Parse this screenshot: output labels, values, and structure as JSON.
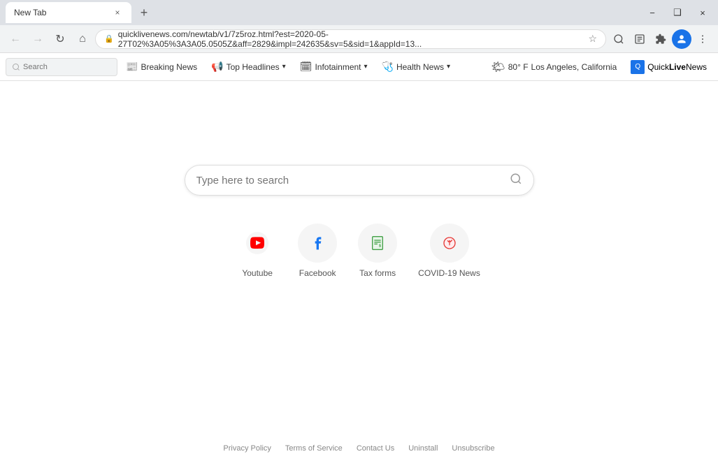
{
  "titleBar": {
    "tabLabel": "New Tab",
    "closeBtn": "×",
    "newTabBtn": "+",
    "minimizeBtn": "−",
    "maximizeBtn": "❑",
    "closeWindowBtn": "×"
  },
  "addressBar": {
    "url": "quicklivenews.com/newtab/v1/7z5roz.html?est=2020-05-27T02%3A05%3A3A05.0505Z&aff=2829&impl=242635&sv=5&sid=1&appId=13...",
    "lockIcon": "🔒"
  },
  "newsBar": {
    "searchPlaceholder": "Search",
    "breakingNewsLabel": "Breaking News",
    "topHeadlinesLabel": "Top Headlines",
    "infotainmentLabel": "Infotainment",
    "healthNewsLabel": "Health News",
    "weatherTemp": "80° F",
    "weatherLocation": "Los Angeles, California",
    "weatherIcon": "🌤",
    "quickLiveNewsLabel": "QuickLiveNews",
    "quickLiveNewsHighlight": "Live"
  },
  "mainContent": {
    "searchPlaceholder": "Type here to search",
    "shortcuts": [
      {
        "id": "youtube",
        "label": "Youtube",
        "type": "youtube"
      },
      {
        "id": "facebook",
        "label": "Facebook",
        "type": "facebook"
      },
      {
        "id": "taxforms",
        "label": "Tax forms",
        "type": "taxforms"
      },
      {
        "id": "covid",
        "label": "COVID-19 News",
        "type": "covid"
      }
    ]
  },
  "footer": {
    "privacyPolicy": "Privacy Policy",
    "termsOfService": "Terms of Service",
    "contactUs": "Contact Us",
    "uninstall": "Uninstall",
    "unsubscribe": "Unsubscribe"
  }
}
